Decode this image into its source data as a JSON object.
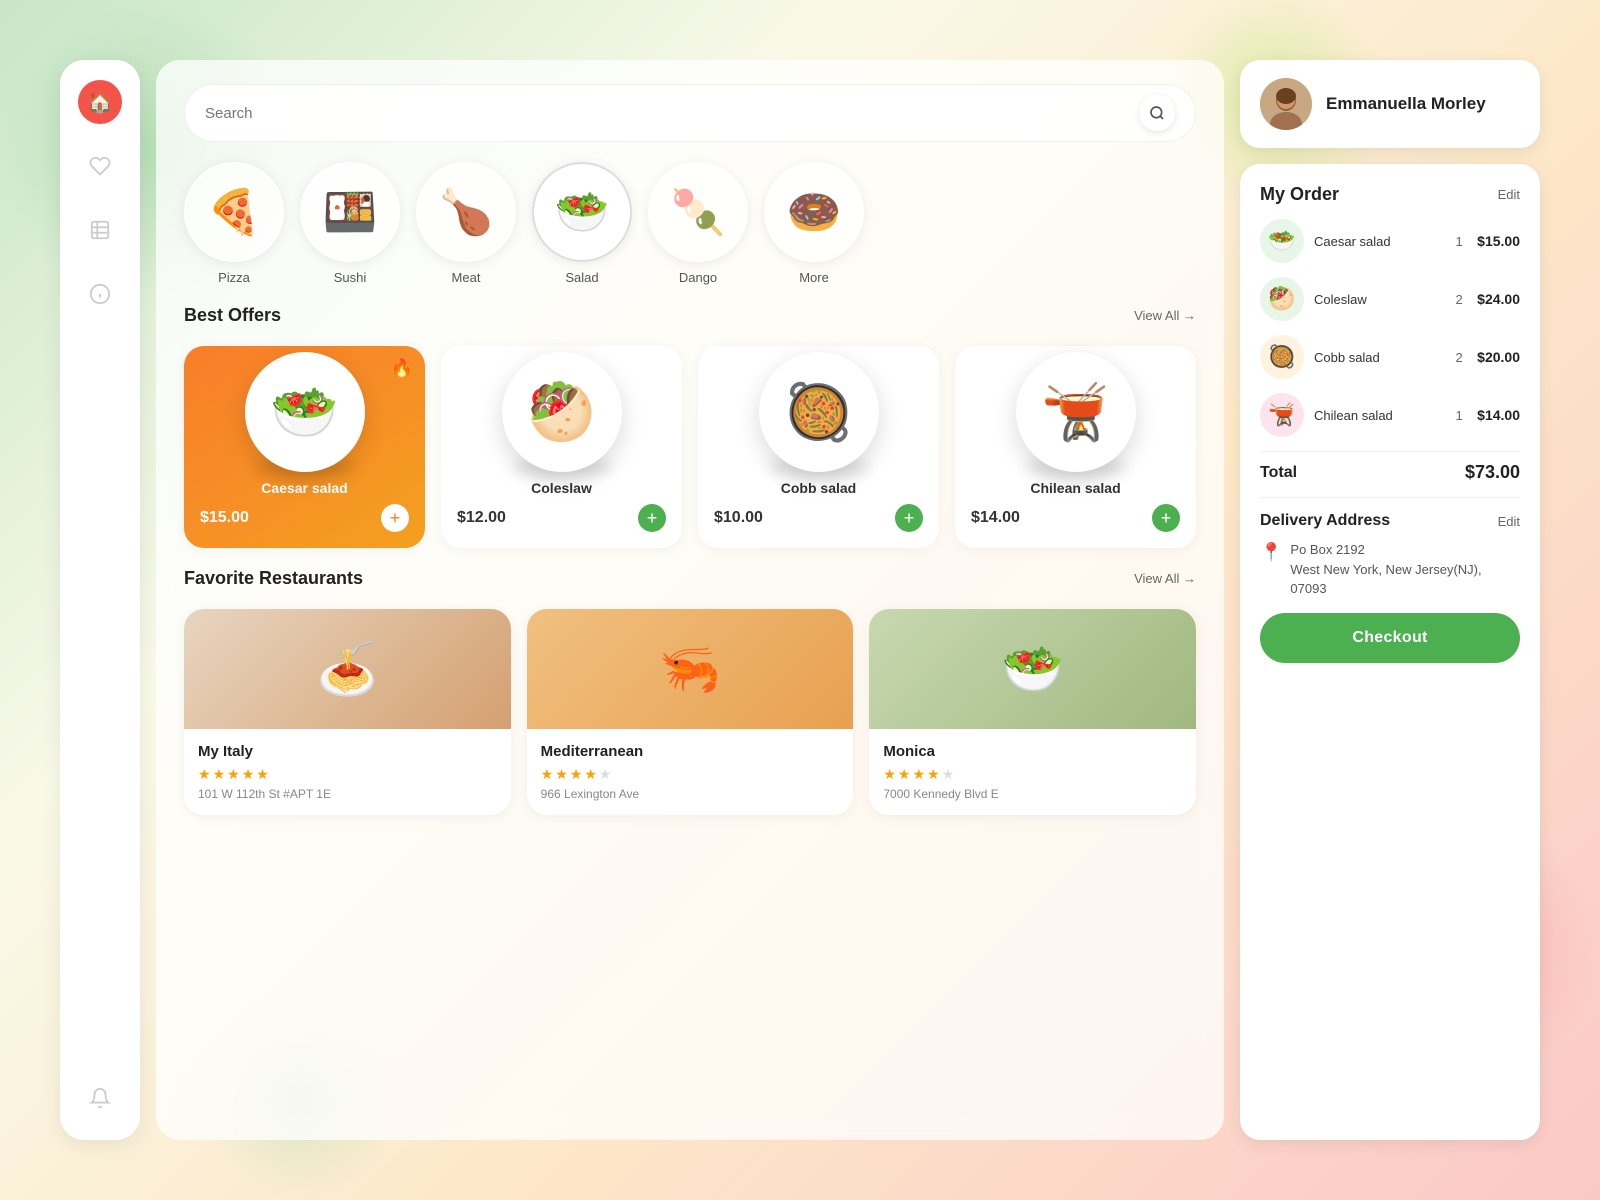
{
  "background": {
    "colors": [
      "#c8e6c9",
      "#f9f9e8",
      "#fde8c8",
      "#fbc8c8"
    ]
  },
  "sidebar": {
    "items": [
      {
        "name": "home",
        "icon": "🏠",
        "active": true
      },
      {
        "name": "favorites",
        "icon": "♡",
        "active": false
      },
      {
        "name": "orders",
        "icon": "☰",
        "active": false
      },
      {
        "name": "info",
        "icon": "ℹ",
        "active": false
      }
    ],
    "notification_icon": "🔔"
  },
  "search": {
    "placeholder": "Search"
  },
  "categories": [
    {
      "name": "Pizza",
      "emoji": "🍕"
    },
    {
      "name": "Sushi",
      "emoji": "🍱"
    },
    {
      "name": "Meat",
      "emoji": "🍗"
    },
    {
      "name": "Salad",
      "emoji": "🥗",
      "selected": true
    },
    {
      "name": "Dango",
      "emoji": "🍡"
    },
    {
      "name": "More",
      "emoji": "🍩"
    }
  ],
  "best_offers": {
    "title": "Best Offers",
    "view_all": "View All →",
    "items": [
      {
        "name": "Caesar salad",
        "price": "$15.00",
        "emoji": "🥗",
        "featured": true
      },
      {
        "name": "Coleslaw",
        "price": "$12.00",
        "emoji": "🥙",
        "featured": false
      },
      {
        "name": "Cobb salad",
        "price": "$10.00",
        "emoji": "🥘",
        "featured": false
      },
      {
        "name": "Chilean salad",
        "price": "$14.00",
        "emoji": "🫕",
        "featured": false
      }
    ]
  },
  "favorite_restaurants": {
    "title": "Favorite Restaurants",
    "view_all": "View All →",
    "items": [
      {
        "name": "My Italy",
        "rating": 4.5,
        "stars": [
          true,
          true,
          true,
          true,
          true
        ],
        "address": "101 W 112th St #APT 1E",
        "emoji": "🍝"
      },
      {
        "name": "Mediterranean",
        "rating": 3.5,
        "stars": [
          true,
          true,
          true,
          true,
          false
        ],
        "address": "966 Lexington Ave",
        "emoji": "🦐"
      },
      {
        "name": "Monica",
        "rating": 3.5,
        "stars": [
          true,
          true,
          true,
          true,
          false
        ],
        "address": "7000 Kennedy Blvd E",
        "emoji": "🥗"
      }
    ]
  },
  "user": {
    "name": "Emmanuella Morley",
    "avatar_emoji": "👩"
  },
  "my_order": {
    "title": "My Order",
    "edit_label": "Edit",
    "items": [
      {
        "name": "Caesar salad",
        "qty": 1,
        "price": "$15.00",
        "emoji": "🥗"
      },
      {
        "name": "Coleslaw",
        "qty": 2,
        "price": "$24.00",
        "emoji": "🥙"
      },
      {
        "name": "Cobb salad",
        "qty": 2,
        "price": "$20.00",
        "emoji": "🥘"
      },
      {
        "name": "Chilean salad",
        "qty": 1,
        "price": "$14.00",
        "emoji": "🫕"
      }
    ],
    "total_label": "Total",
    "total_amount": "$73.00"
  },
  "delivery": {
    "title": "Delivery Address",
    "edit_label": "Edit",
    "address": "Po Box 2192\nWest New York, New Jersey(NJ), 07093"
  },
  "checkout": {
    "label": "Checkout"
  }
}
